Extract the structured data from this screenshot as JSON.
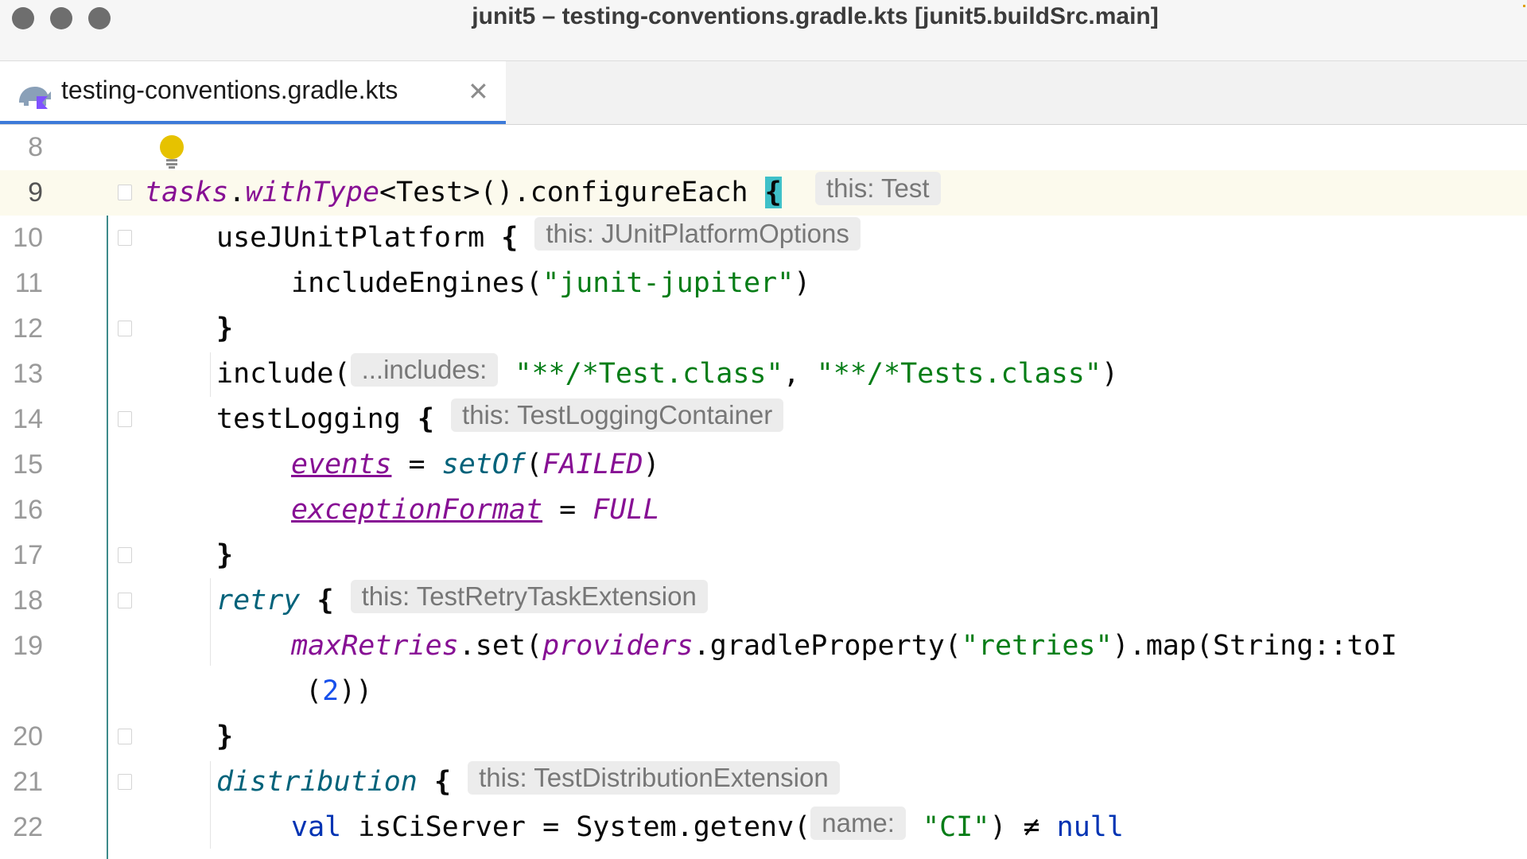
{
  "window": {
    "title": "junit5 – testing-conventions.gradle.kts [junit5.buildSrc.main]"
  },
  "tab": {
    "label": "testing-conventions.gradle.kts",
    "icon": "gradle-kotlin-icon",
    "close_glyph": "✕"
  },
  "editor": {
    "lines": [
      {
        "n": "8"
      },
      {
        "n": "9",
        "t1": "tasks",
        "t2": ".",
        "t3": "withType",
        "t4": "<Test>().configureEach ",
        "t5": "{",
        "hint": "this: Test"
      },
      {
        "n": "10",
        "t1": "useJUnitPlatform ",
        "t2": "{",
        "hint": "this: JUnitPlatformOptions"
      },
      {
        "n": "11",
        "t1": "includeEngines(",
        "t2": "\"junit-jupiter\"",
        "t3": ")"
      },
      {
        "n": "12",
        "t1": "}"
      },
      {
        "n": "13",
        "t1": "include(",
        "hint": "...includes:",
        "t2": "\"**/*Test.class\"",
        "t3": ", ",
        "t4": "\"**/*Tests.class\"",
        "t5": ")"
      },
      {
        "n": "14",
        "t1": "testLogging ",
        "t2": "{",
        "hint": "this: TestLoggingContainer"
      },
      {
        "n": "15",
        "t1": "events",
        "t2": " = ",
        "t3": "setOf",
        "t4": "(",
        "t5": "FAILED",
        "t6": ")"
      },
      {
        "n": "16",
        "t1": "exceptionFormat",
        "t2": " = ",
        "t3": "FULL"
      },
      {
        "n": "17",
        "t1": "}"
      },
      {
        "n": "18",
        "t1": "retry",
        "t2": " ",
        "t3": "{",
        "hint": "this: TestRetryTaskExtension"
      },
      {
        "n": "19",
        "t1": "maxRetries",
        "t2": ".set(",
        "t3": "providers",
        "t4": ".gradleProperty(",
        "t5": "\"retries\"",
        "t6": ").map(String::toI"
      },
      {
        "n": "",
        "t1": "(",
        "t2": "2",
        "t3": "))"
      },
      {
        "n": "20",
        "t1": "}"
      },
      {
        "n": "21",
        "t1": "distribution",
        "t2": " ",
        "t3": "{",
        "hint": "this: TestDistributionExtension"
      },
      {
        "n": "22",
        "t1": "val",
        "t2": " isCiServer = System.getenv(",
        "hint": "name:",
        "t3": "\"CI\"",
        "t4": ") ",
        "t5": "≠",
        "t6": " ",
        "t7": "null"
      }
    ]
  },
  "icons": {
    "intention": "lightbulb-icon",
    "fold": "fold-marker-icon"
  }
}
